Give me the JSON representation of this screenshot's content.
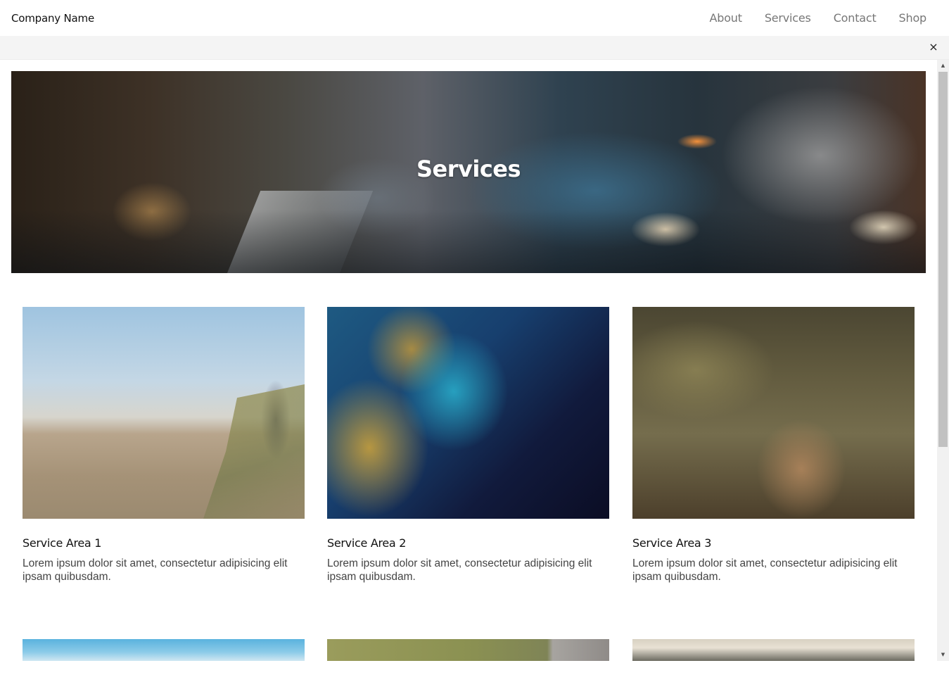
{
  "navbar": {
    "brand": "Company Name",
    "links": [
      "About",
      "Services",
      "Contact",
      "Shop"
    ]
  },
  "preview_bar": {
    "close_glyph": "×"
  },
  "scrollbar": {
    "up_glyph": "▲",
    "down_glyph": "▼"
  },
  "hero": {
    "title": "Services"
  },
  "services": [
    {
      "title": "Service Area 1",
      "text": "Lorem ipsum dolor sit amet, consectetur adipisicing elit ipsam quibusdam.",
      "image": "beach-photo"
    },
    {
      "title": "Service Area 2",
      "text": "Lorem ipsum dolor sit amet, consectetur adipisicing elit ipsam quibusdam.",
      "image": "earth-satellite-photo"
    },
    {
      "title": "Service Area 3",
      "text": "Lorem ipsum dolor sit amet, consectetur adipisicing elit ipsam quibusdam.",
      "image": "deer-photo"
    }
  ],
  "colors": {
    "nav_link": "#777777",
    "preview_bar_bg": "#f4f4f4",
    "hero_title": "#ffffff"
  }
}
